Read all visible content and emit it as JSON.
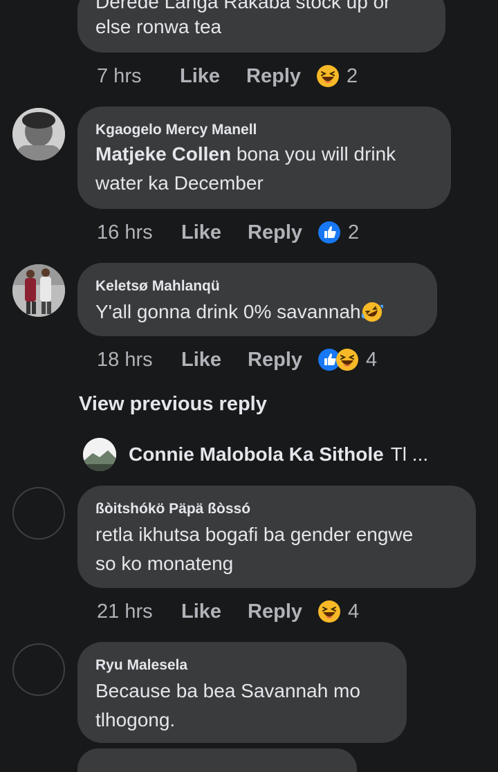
{
  "comments": [
    {
      "cut_line": "Derede Langa Rakaba stock up or",
      "text_lines": [
        "else ronwa tea"
      ],
      "time": "7 hrs",
      "like": "Like",
      "reply": "Reply",
      "reaction_icons": [
        "haha"
      ],
      "reaction_count": "2"
    },
    {
      "author": "Kgaogelo Mercy Manell",
      "mention": "Matjeke Collen",
      "text_line1_rest": " bona you will drink",
      "text_line2": "water ka December",
      "time": "16 hrs",
      "like": "Like",
      "reply": "Reply",
      "reaction_icons": [
        "like"
      ],
      "reaction_count": "2"
    },
    {
      "author": "Keletsø Mahlanqü",
      "text": "Y'all gonna drink 0% savannah",
      "time": "18 hrs",
      "like": "Like",
      "reply": "Reply",
      "reaction_icons": [
        "like",
        "haha"
      ],
      "reaction_count": "4"
    },
    {
      "author": "ßòitshókö Päpä ßòssó",
      "text_lines": [
        "retla ikhutsa bogafi ba gender engwe",
        "so ko monateng"
      ],
      "time": "21 hrs",
      "like": "Like",
      "reply": "Reply",
      "reaction_icons": [
        "haha"
      ],
      "reaction_count": "4"
    },
    {
      "author": "Ryu Malesela",
      "text_lines": [
        "Because ba bea Savannah mo",
        "tlhogong."
      ]
    }
  ],
  "view_previous": "View previous reply",
  "nested_reply": {
    "author": "Connie Malobola Ka Sithole",
    "preview": "Tl ..."
  },
  "colors": {
    "background": "#18191a",
    "bubble": "#3a3b3c",
    "secondary_text": "#b0b3b8",
    "like_blue": "#1877f2",
    "haha_yellow": "#f7b928"
  }
}
